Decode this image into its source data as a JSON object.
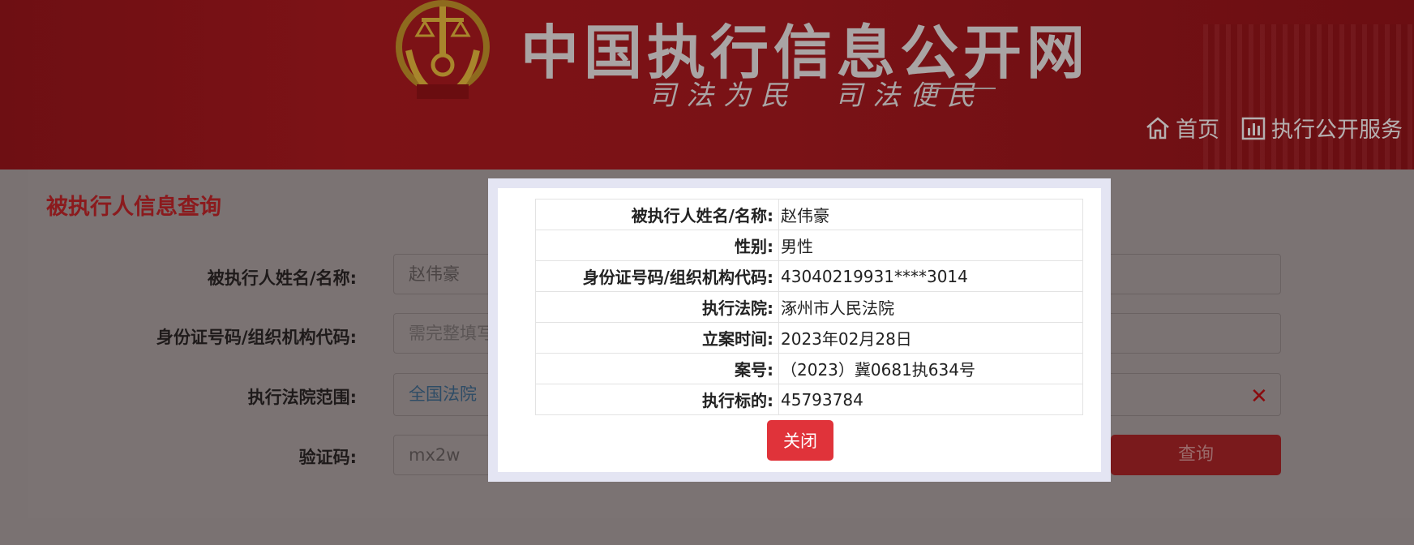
{
  "header": {
    "site_title": "中国执行信息公开网",
    "slogan": "司法为民　司法便民",
    "nav": [
      {
        "label": "首页",
        "icon": "home-icon"
      },
      {
        "label": "执行公开服务",
        "icon": "bar-chart-icon"
      }
    ]
  },
  "form": {
    "title": "被执行人信息查询",
    "fields": [
      {
        "label": "被执行人姓名/名称:",
        "value": "赵伟豪"
      },
      {
        "label": "身份证号码/组织机构代码:",
        "placeholder": "需完整填写"
      },
      {
        "label": "执行法院范围:",
        "value": "全国法院"
      },
      {
        "label": "验证码:",
        "value": "mx2w"
      }
    ],
    "query_button": "查询",
    "clear_icon": "close-icon"
  },
  "modal": {
    "rows": [
      {
        "label": "被执行人姓名/名称:",
        "value": "赵伟豪"
      },
      {
        "label": "性别:",
        "value": "男性"
      },
      {
        "label": "身份证号码/组织机构代码:",
        "value": "43040219931****3014"
      },
      {
        "label": "执行法院:",
        "value": "涿州市人民法院"
      },
      {
        "label": "立案时间:",
        "value": "2023年02月28日"
      },
      {
        "label": "案号:",
        "value": "（2023）冀0681执634号"
      },
      {
        "label": "执行标的:",
        "value": "45793784"
      }
    ],
    "close_button": "关闭"
  },
  "colors": {
    "header_red": "#7a1216",
    "overlay": "#7b7373",
    "close_button": "#e0333a",
    "title_red": "#8b1a1d"
  }
}
